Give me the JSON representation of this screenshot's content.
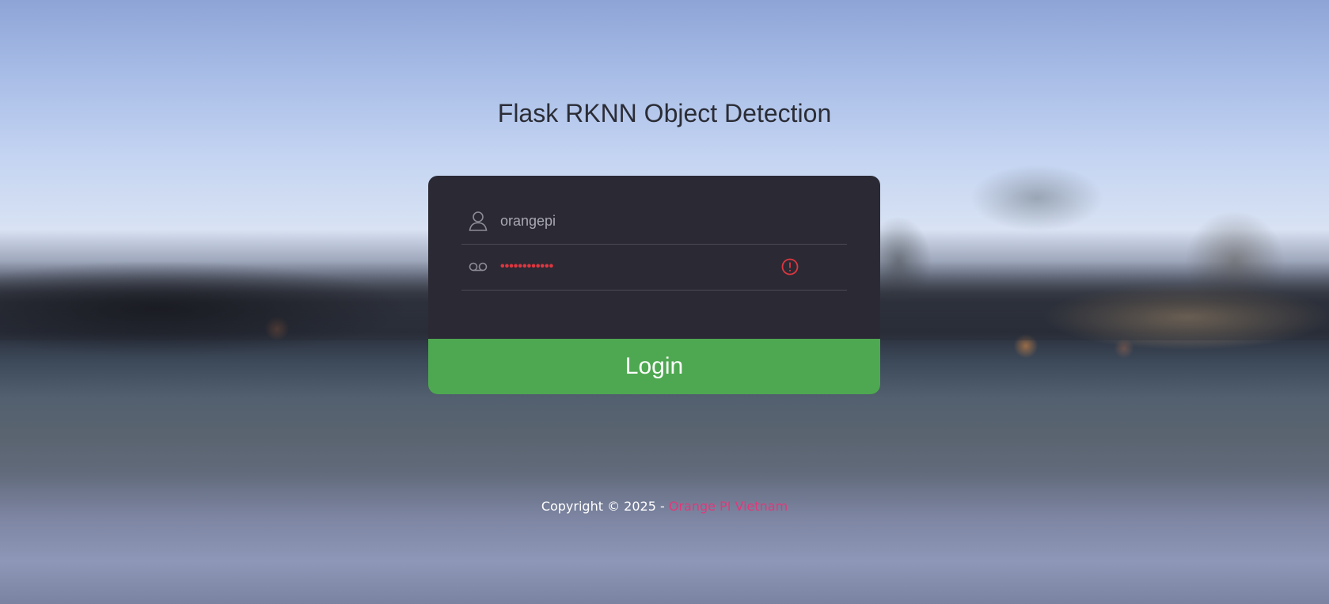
{
  "app": {
    "title": "Flask RKNN Object Detection"
  },
  "login_form": {
    "username_value": "orangepi",
    "password_masked": "••••••••••••",
    "username_icon": "user-icon",
    "password_icon": "key-icon",
    "password_status_icon": "alert-circle-icon",
    "submit_label": "Login"
  },
  "footer": {
    "copyright_text": "Copyright © 2025 -",
    "link_text": "Orange PI Vietnam"
  },
  "colors": {
    "card_background": "#2b2a34",
    "button_green": "#4ea851",
    "error_red": "#e0363f",
    "footer_link": "#e0397a"
  }
}
